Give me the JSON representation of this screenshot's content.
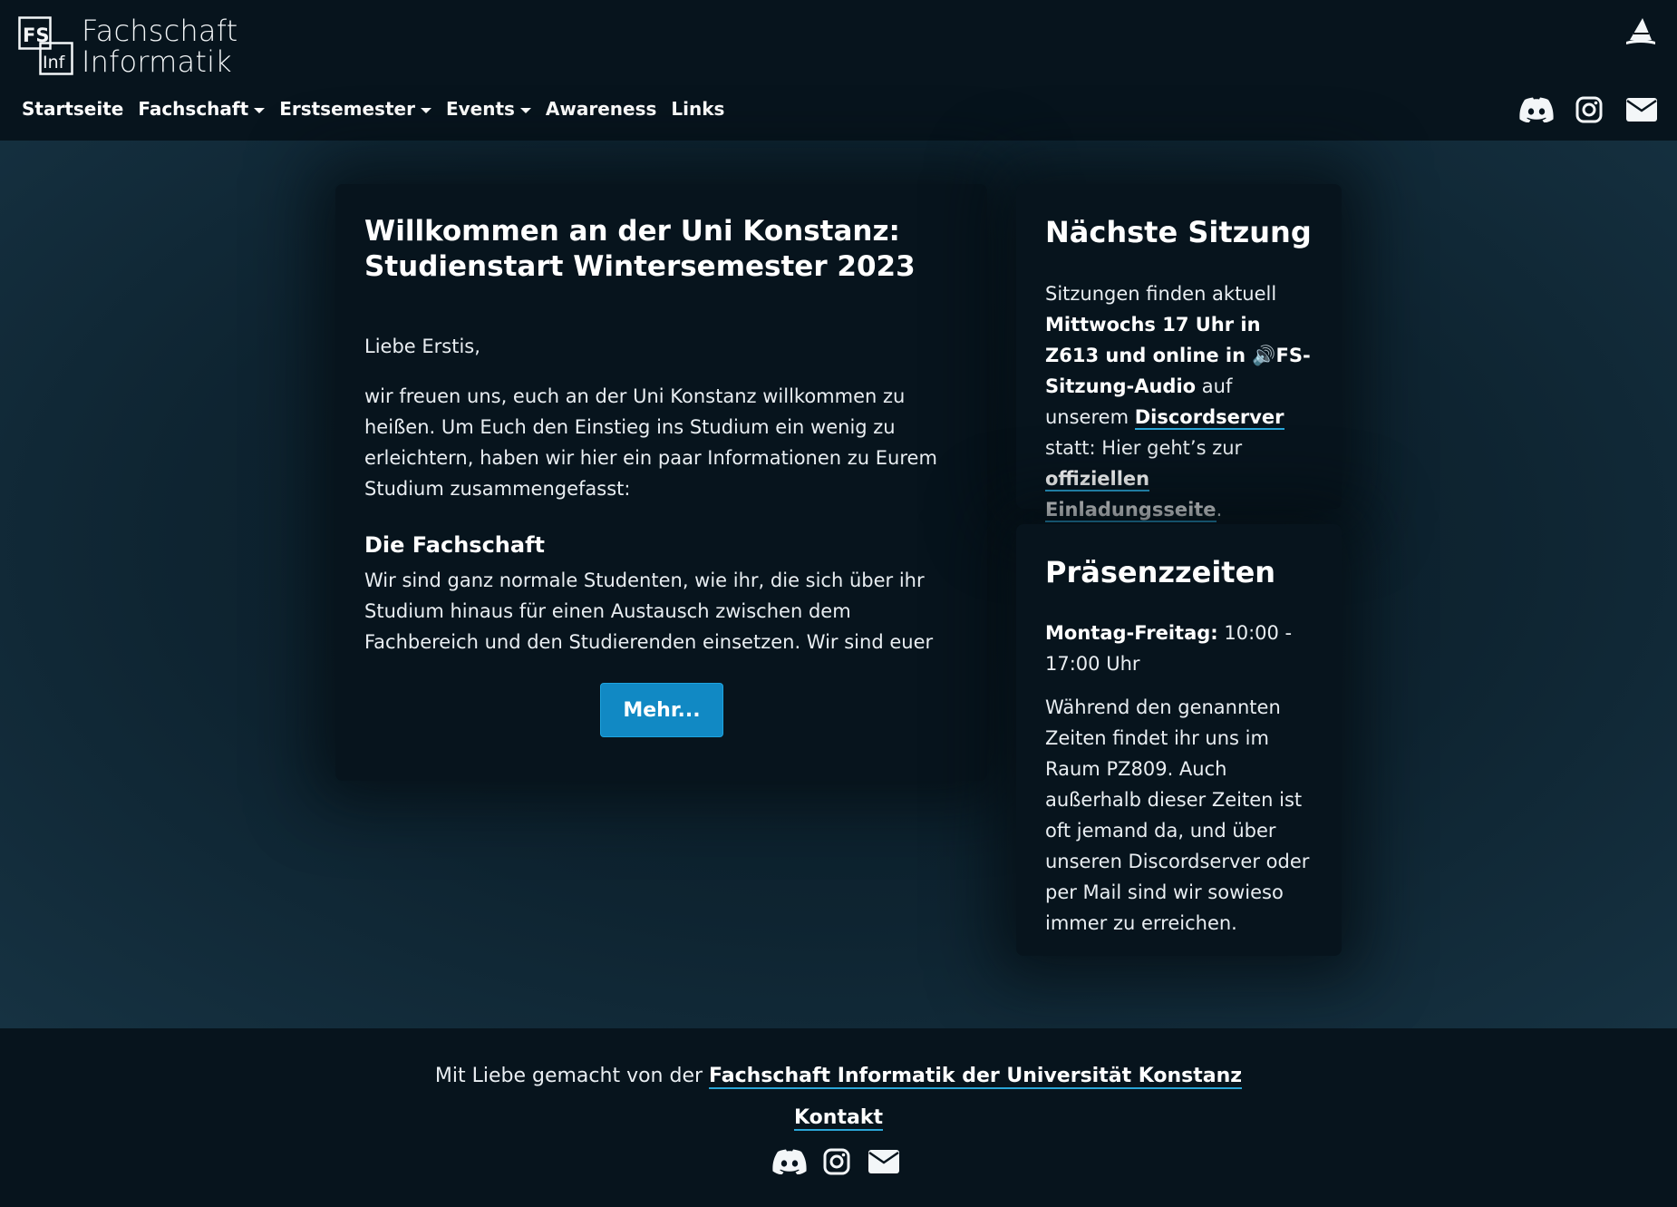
{
  "header": {
    "logo_line1": "Fachschaft",
    "logo_line2": "Informatik",
    "logo_mark_top": "FS",
    "logo_mark_bottom": "Inf"
  },
  "nav": {
    "items": [
      {
        "label": "Startseite",
        "dropdown": false
      },
      {
        "label": "Fachschaft",
        "dropdown": true
      },
      {
        "label": "Erstsemester",
        "dropdown": true
      },
      {
        "label": "Events",
        "dropdown": true
      },
      {
        "label": "Awareness",
        "dropdown": false
      },
      {
        "label": "Links",
        "dropdown": false
      }
    ],
    "social_icons": [
      "discord-icon",
      "instagram-icon",
      "mail-icon"
    ],
    "theme_icon": "wizard-hat-icon"
  },
  "main_card": {
    "title_line1": "Willkommen an der Uni Konstanz:",
    "title_line2": "Studienstart Wintersemester 2023",
    "greeting": "Liebe Erstis,",
    "intro": "wir freuen uns, euch an der Uni Konstanz willkommen zu heißen. Um Euch den Einstieg ins Studium ein wenig zu erleichtern, haben wir hier ein paar Informationen zu Eurem Studium zusammengefasst:",
    "section_title": "Die Fachschaft",
    "section_text": "Wir sind ganz normale Studenten, wie ihr, die sich über ihr Studium hinaus für einen Austausch zwischen dem Fachbereich und den Studierenden einsetzen. Wir sind euer Ansprechpartner",
    "more_button": "Mehr..."
  },
  "sitzung_card": {
    "title": "Nächste Sitzung",
    "text_1": "Sitzungen finden aktuell ",
    "bold_1": "Mittwochs 17 Uhr in Z613 und online in 🔊FS-Sitzung-Audio",
    "text_2": " auf unserem ",
    "link_discord": "Discordserver",
    "text_3": " statt: Hier geht’s zur ",
    "link_invite": "offiziellen Einladungsseite",
    "text_4": "."
  },
  "praesenz_card": {
    "title": "Präsenzzeiten",
    "hours_label": "Montag-Freitag:",
    "hours_value": " 10:00 - 17:00 Uhr",
    "description": "Während den genannten Zeiten findet ihr uns im Raum PZ809. Auch außerhalb dieser Zeiten ist oft jemand da, und über unseren Discordserver oder per Mail sind wir sowieso immer zu erreichen."
  },
  "footer": {
    "made_by_prefix": "Mit Liebe gemacht von der ",
    "made_by_link": "Fachschaft Informatik der Universität Konstanz",
    "contact": "Kontakt",
    "social_icons": [
      "discord-icon",
      "instagram-icon",
      "mail-icon"
    ]
  },
  "colors": {
    "background": "#07141d",
    "accent": "#1189c4",
    "link_underline": "#2aa6d8"
  }
}
